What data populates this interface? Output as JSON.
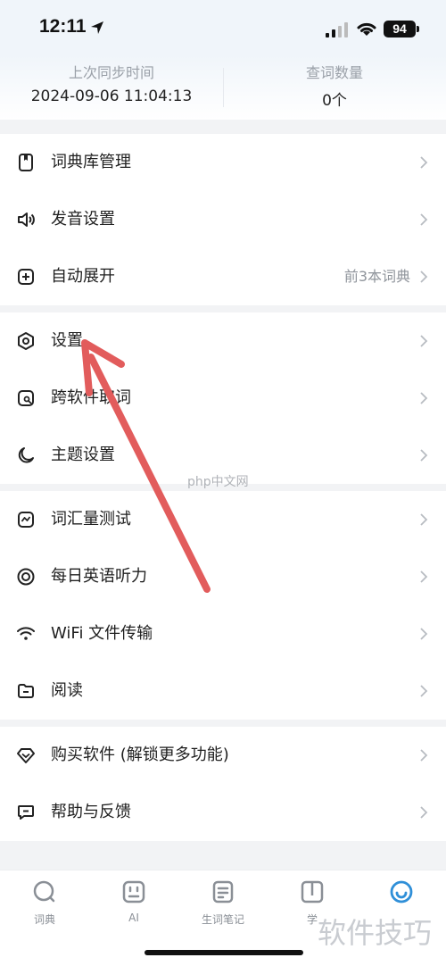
{
  "status_bar": {
    "time": "12:11",
    "battery": "94"
  },
  "sync": {
    "last_sync_label": "上次同步时间",
    "last_sync_value": "2024-09-06 11:04:13",
    "lookup_count_label": "查词数量",
    "lookup_count_value": "0个"
  },
  "menu": {
    "dictionary_manage": "词典库管理",
    "pronunciation": "发音设置",
    "auto_expand": "自动展开",
    "auto_expand_value": "前3本词典",
    "settings": "设置",
    "cross_app_lookup": "跨软件取词",
    "theme": "主题设置",
    "vocab_test": "词汇量测试",
    "daily_listening": "每日英语听力",
    "wifi_transfer": "WiFi 文件传输",
    "reading": "阅读",
    "purchase": "购买软件 (解锁更多功能)",
    "help": "帮助与反馈"
  },
  "tabs": [
    {
      "label": "词典",
      "icon": "search-icon"
    },
    {
      "label": "AI",
      "icon": "ai-icon"
    },
    {
      "label": "生词笔记",
      "icon": "notes-icon"
    },
    {
      "label": "学",
      "icon": "book-icon"
    },
    {
      "label": "",
      "icon": "profile-icon",
      "active": true
    }
  ],
  "watermarks": {
    "center": "php中文网",
    "corner": "软件技巧"
  },
  "colors": {
    "accent": "#2f8fd8",
    "annotation_arrow": "#e25c5c"
  }
}
